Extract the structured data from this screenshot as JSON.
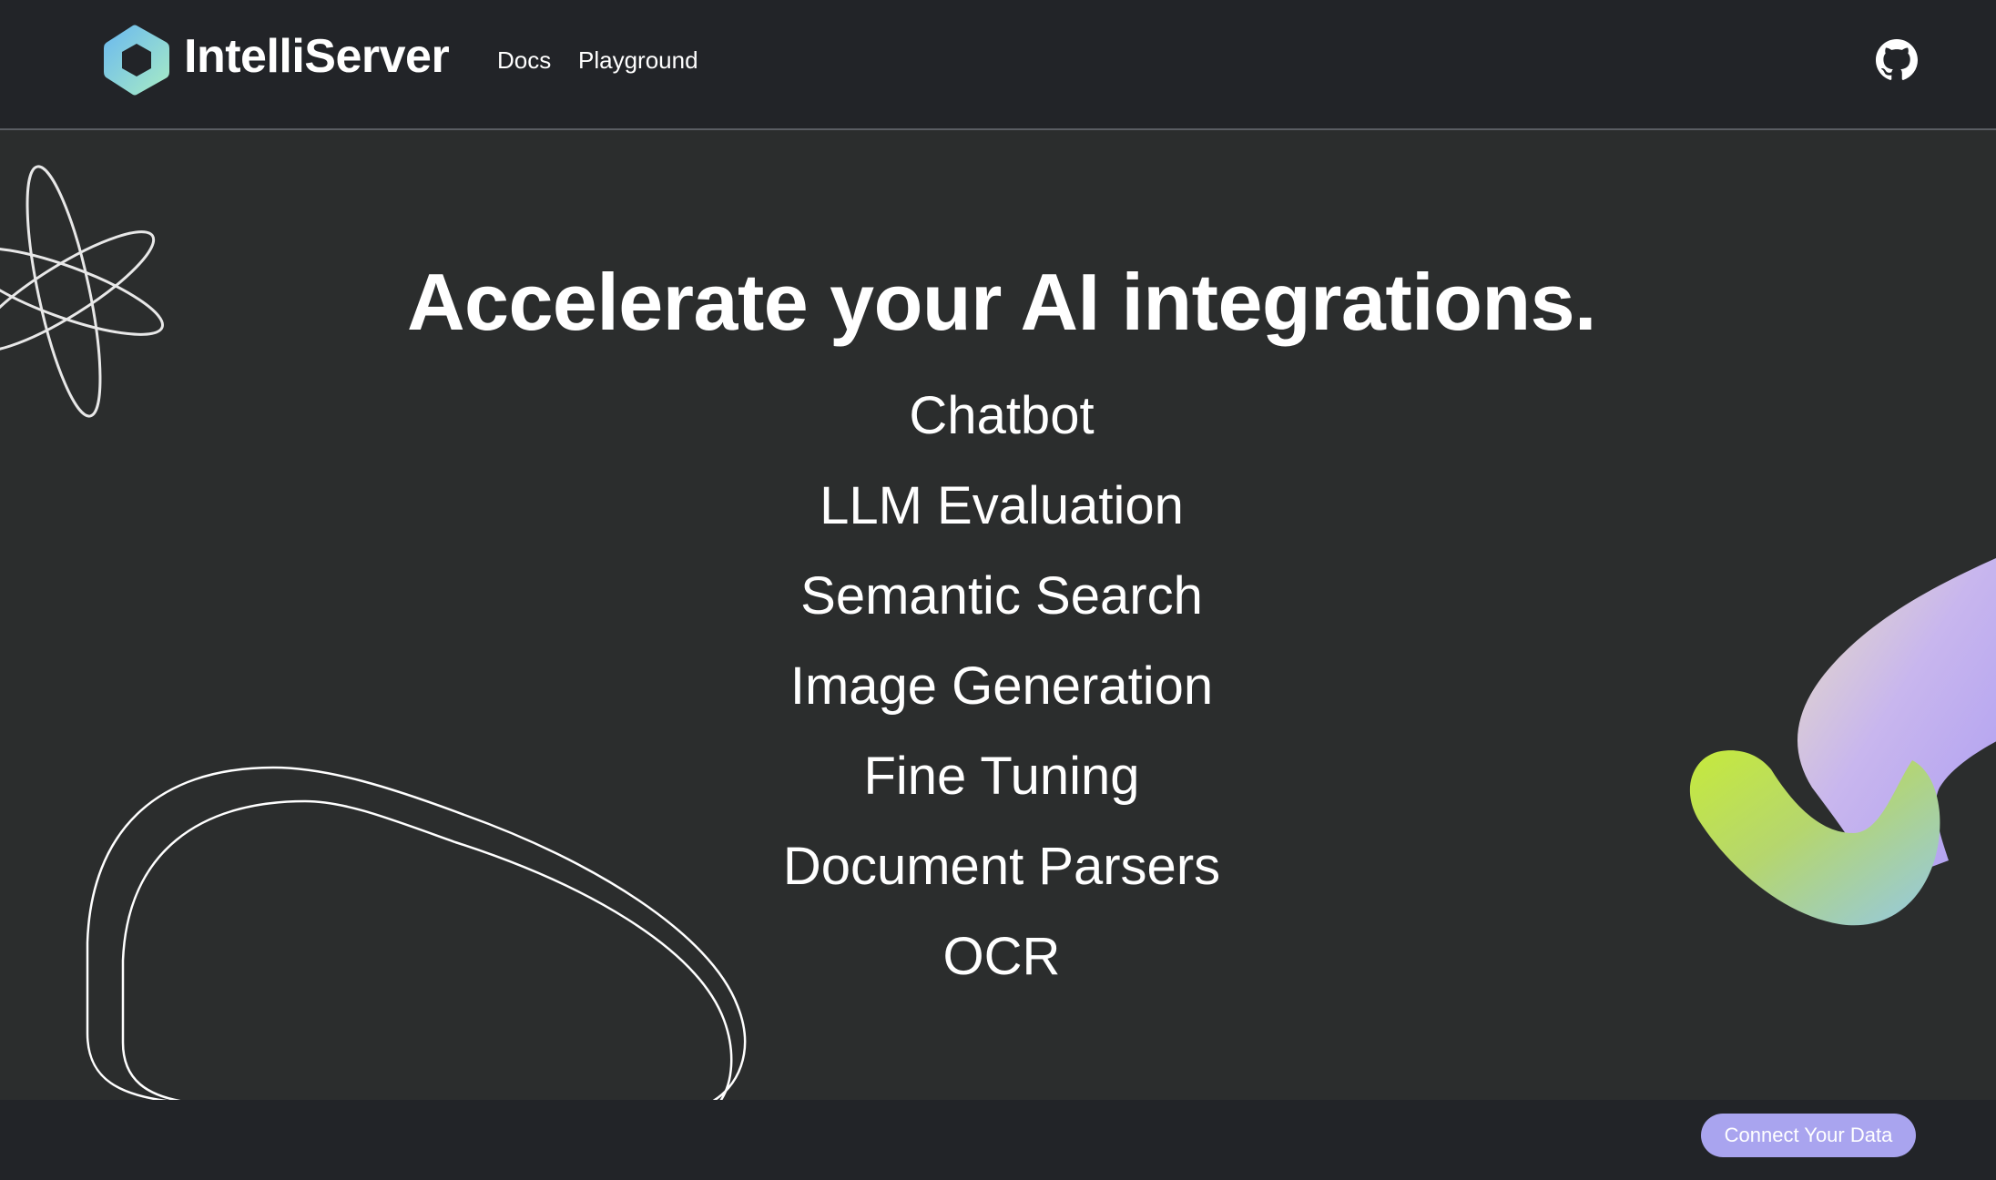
{
  "header": {
    "brand_name": "IntelliServer",
    "nav": [
      {
        "label": "Docs"
      },
      {
        "label": "Playground"
      }
    ],
    "github_icon": "github-icon"
  },
  "hero": {
    "headline": "Accelerate your AI integrations.",
    "features": [
      "Chatbot",
      "LLM Evaluation",
      "Semantic Search",
      "Image Generation",
      "Fine Tuning",
      "Document Parsers",
      "OCR"
    ]
  },
  "footer": {
    "cta_label": "Connect Your Data"
  },
  "colors": {
    "header_bg": "#222428",
    "page_bg": "#2b2d2d",
    "cta_bg": "#a9a4ef",
    "logo_gradient_start": "#7cc4ec",
    "logo_gradient_end": "#9fe3c8",
    "text": "#ffffff"
  }
}
